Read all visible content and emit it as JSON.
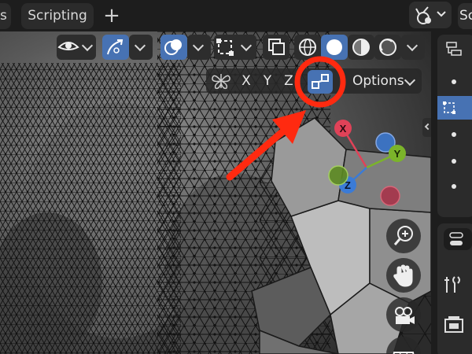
{
  "workspace_tabs": {
    "prev_tab_fragment": "s",
    "scripting": "Scripting",
    "add_tab": "+"
  },
  "scene": {
    "label_fragment": "Sc"
  },
  "viewport_header": {
    "icons": [
      "visibility-eye-icon",
      "gizmo-arrow-icon",
      "overlays-icon",
      "mesh-edit-overlay-icon",
      "xray-icon",
      "wireframe-shading-icon",
      "solid-shading-icon",
      "material-shading-icon",
      "rendered-shading-icon"
    ]
  },
  "mirror_options": {
    "x": "X",
    "y": "Y",
    "z": "Z",
    "options": "Options"
  },
  "gizmo": {
    "x_label": "X",
    "y_label": "Y",
    "z_label": "Z"
  },
  "navigation_icons": [
    "zoom-icon",
    "pan-hand-icon",
    "camera-view-icon",
    "grid-view-icon"
  ],
  "annotation": {
    "highlight_color": "#ff2a10",
    "target": "auto-merge-vertices-toggle"
  },
  "colors": {
    "accent": "#4772b3",
    "axis_x": "#e04258",
    "axis_y": "#7bb42a",
    "axis_z": "#3b7bd6"
  }
}
